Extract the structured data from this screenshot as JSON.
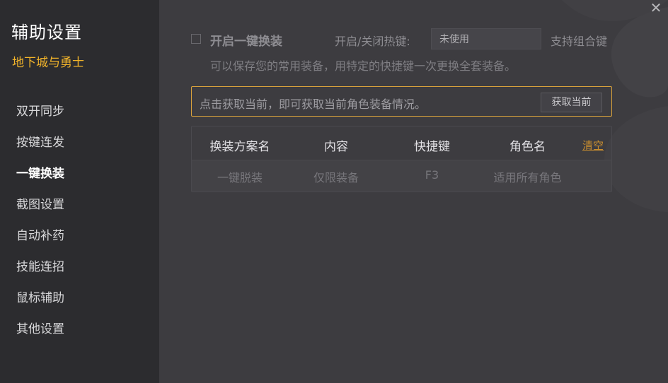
{
  "sidebar": {
    "title": "辅助设置",
    "game": "地下城与勇士",
    "items": [
      {
        "label": "双开同步",
        "active": false
      },
      {
        "label": "按键连发",
        "active": false
      },
      {
        "label": "一键换装",
        "active": true
      },
      {
        "label": "截图设置",
        "active": false
      },
      {
        "label": "自动补药",
        "active": false
      },
      {
        "label": "技能连招",
        "active": false
      },
      {
        "label": "鼠标辅助",
        "active": false
      },
      {
        "label": "其他设置",
        "active": false
      }
    ]
  },
  "main": {
    "close_glyph": "✕",
    "enable_label": "开启一键换装",
    "enable_checked": false,
    "hotkey_label": "开启/关闭热键:",
    "hotkey_value": "未使用",
    "combo_hint": "支持组合键",
    "description": "可以保存您的常用装备，用特定的快捷键一次更换全套装备。",
    "fetch_hint": "点击获取当前，即可获取当前角色装备情况。",
    "fetch_button": "获取当前",
    "table": {
      "headers": [
        "换装方案名",
        "内容",
        "快捷键",
        "角色名"
      ],
      "clear_label": "清空",
      "rows": [
        [
          "一键脱装",
          "仅限装备",
          "F3",
          "适用所有角色"
        ]
      ]
    }
  },
  "colors": {
    "accent": "#f2b42a",
    "border_highlight": "#d9a23c",
    "link": "#c98e2f",
    "sidebar_bg": "#2c2c2f",
    "main_bg": "#3d3c40"
  }
}
